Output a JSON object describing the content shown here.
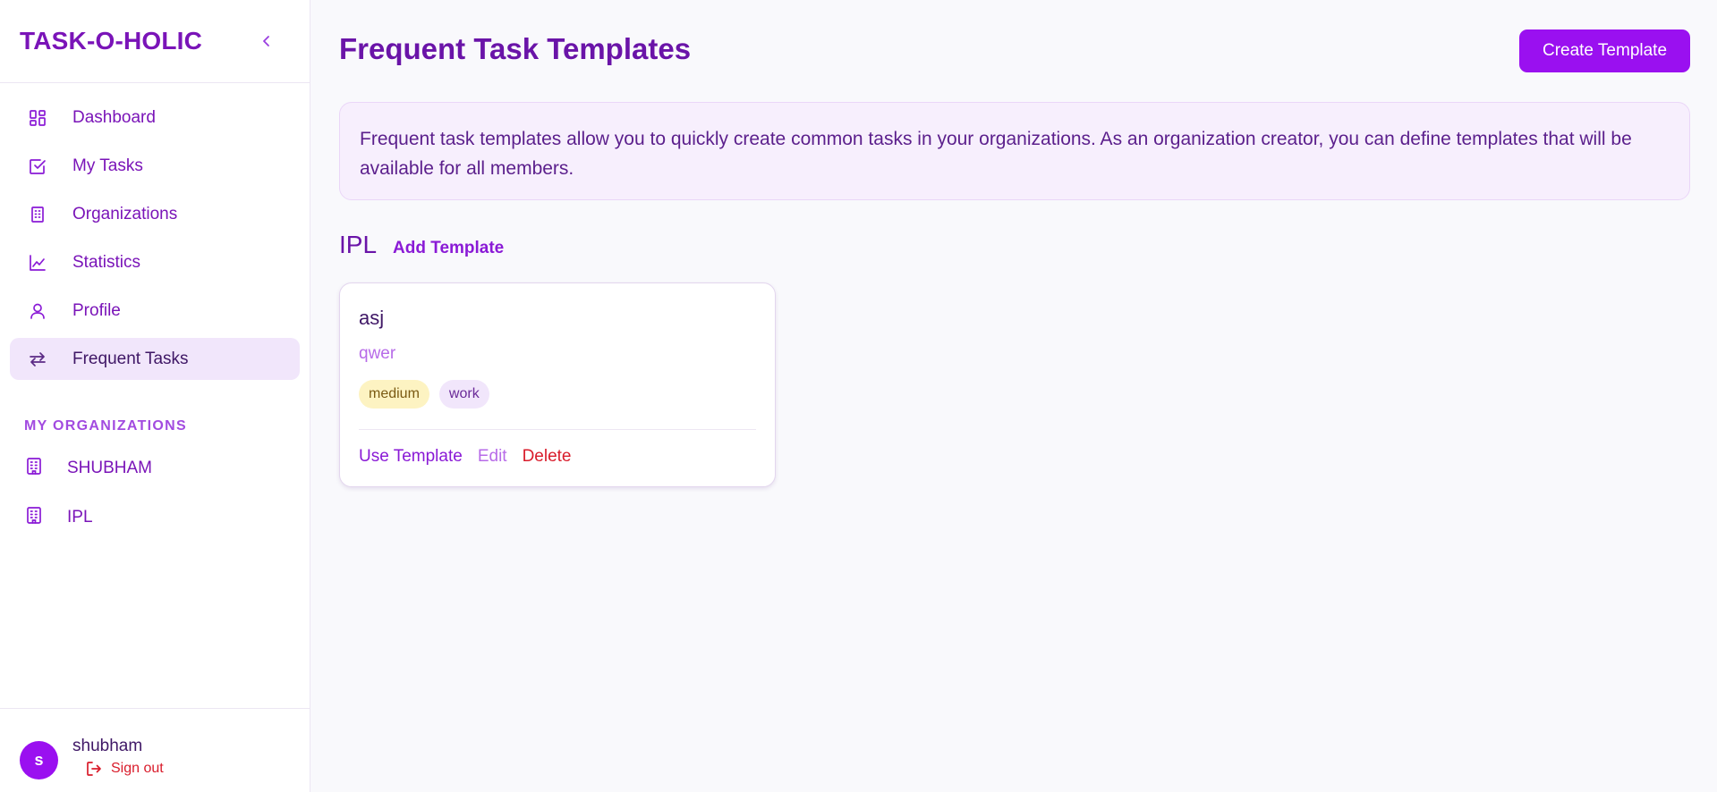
{
  "sidebar": {
    "brand": "TASK-O-HOLIC",
    "nav": [
      {
        "label": "Dashboard",
        "icon": "dashboard-icon"
      },
      {
        "label": "My Tasks",
        "icon": "checkbox-icon"
      },
      {
        "label": "Organizations",
        "icon": "building-icon"
      },
      {
        "label": "Statistics",
        "icon": "chart-icon"
      },
      {
        "label": "Profile",
        "icon": "user-icon"
      },
      {
        "label": "Frequent Tasks",
        "icon": "repeat-icon",
        "active": true
      }
    ],
    "section_title": "MY ORGANIZATIONS",
    "organizations": [
      {
        "label": "SHUBHAM",
        "icon": "building-icon"
      },
      {
        "label": "IPL",
        "icon": "building-icon"
      }
    ],
    "user": {
      "avatar_letter": "s",
      "name": "shubham",
      "signout_label": "Sign out"
    }
  },
  "header": {
    "title": "Frequent Task Templates",
    "create_label": "Create Template"
  },
  "info": {
    "text": "Frequent task templates allow you to quickly create common tasks in your organizations. As an organization creator, you can define templates that will be available for all members."
  },
  "groups": [
    {
      "name": "IPL",
      "add_label": "Add Template",
      "templates": [
        {
          "title": "asj",
          "description": "qwer",
          "priority": "medium",
          "category": "work",
          "actions": {
            "use": "Use Template",
            "edit": "Edit",
            "delete": "Delete"
          }
        }
      ]
    }
  ],
  "colors": {
    "brand": "#7a14b8",
    "accent": "#9a10f0",
    "danger": "#d91c2b",
    "active_bg": "#f1e6fb"
  }
}
